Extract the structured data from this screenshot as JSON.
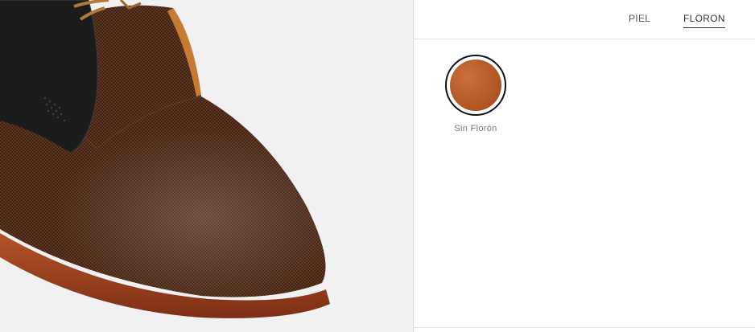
{
  "tabs": [
    {
      "label": "PIEL",
      "active": false
    },
    {
      "label": "FLORON",
      "active": true
    }
  ],
  "options": [
    {
      "label": "Sin Florón",
      "color": "#b65a27",
      "selected": true
    }
  ],
  "colors": {
    "accent": "#333333",
    "preview_background": "#f1f1f1",
    "shoe_vamp": "#4a2818",
    "shoe_quarter": "#1c1c1c",
    "shoe_sole": "#a0421e",
    "laces": "#b07a3a"
  }
}
